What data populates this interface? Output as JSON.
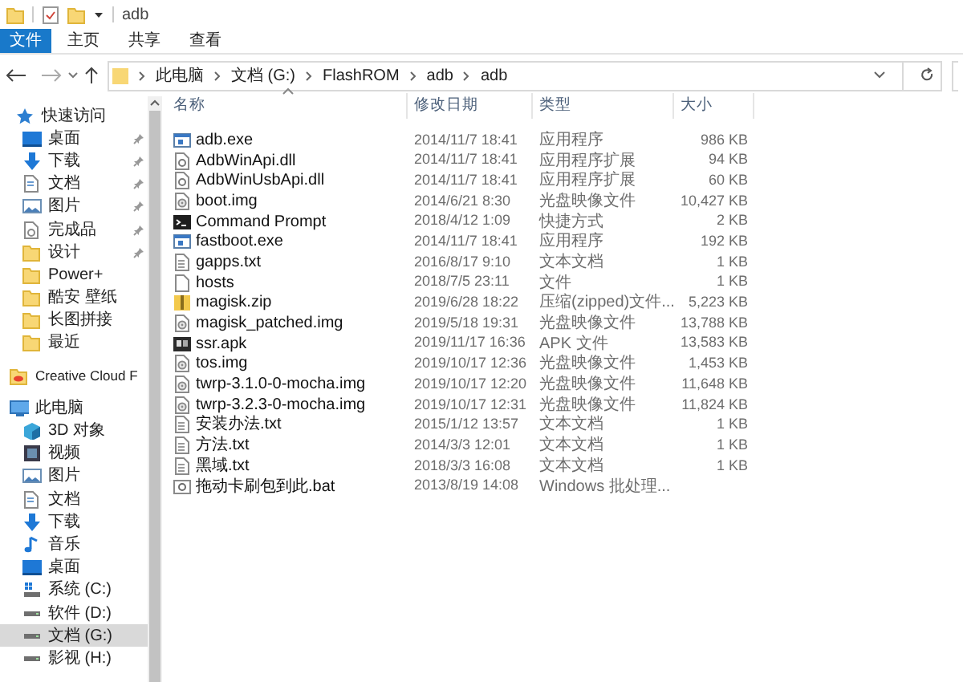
{
  "title_bar": {
    "title": "adb"
  },
  "ribbon_tabs": [
    {
      "label": "文件",
      "kind": "file_menu"
    },
    {
      "label": "主页",
      "kind": "tab"
    },
    {
      "label": "共享",
      "kind": "tab"
    },
    {
      "label": "查看",
      "kind": "tab"
    }
  ],
  "address_bar": {
    "path": [
      "此电脑",
      "文档 (G:)",
      "FlashROM",
      "adb",
      "adb"
    ]
  },
  "sidebar": {
    "groups": [
      {
        "label": "快速访问",
        "kind": "star",
        "selected": false,
        "children": [
          {
            "label": "桌面",
            "kind": "desktop",
            "pinned": true,
            "selected": false
          },
          {
            "label": "下载",
            "kind": "download",
            "pinned": true,
            "selected": false
          },
          {
            "label": "文档",
            "kind": "document",
            "pinned": true,
            "selected": false
          },
          {
            "label": "图片",
            "kind": "picture",
            "pinned": true,
            "selected": false
          },
          {
            "label": "完成品",
            "kind": "special",
            "pinned": true,
            "selected": false
          },
          {
            "label": "设计",
            "kind": "folder",
            "pinned": true,
            "selected": false
          },
          {
            "label": "Power+",
            "kind": "folder",
            "pinned": false,
            "selected": false
          },
          {
            "label": "酷安 壁纸",
            "kind": "folder",
            "pinned": false,
            "selected": false
          },
          {
            "label": "长图拼接",
            "kind": "folder",
            "pinned": false,
            "selected": false
          },
          {
            "label": "最近",
            "kind": "folder",
            "pinned": false,
            "selected": false
          }
        ]
      },
      {
        "label": "Creative Cloud F",
        "kind": "cloud",
        "selected": false
      },
      {
        "label": "此电脑",
        "kind": "computer",
        "selected": false,
        "children": [
          {
            "label": "3D 对象",
            "kind": "cube",
            "selected": false
          },
          {
            "label": "视频",
            "kind": "video",
            "selected": false
          },
          {
            "label": "图片",
            "kind": "picture",
            "selected": false
          },
          {
            "label": "文档",
            "kind": "document",
            "selected": false
          },
          {
            "label": "下载",
            "kind": "download",
            "selected": false
          },
          {
            "label": "音乐",
            "kind": "music",
            "selected": false
          },
          {
            "label": "桌面",
            "kind": "desktop",
            "selected": false
          },
          {
            "label": "系统 (C:)",
            "kind": "system_drive",
            "selected": false
          },
          {
            "label": "软件 (D:)",
            "kind": "drive",
            "selected": false
          },
          {
            "label": "文档 (G:)",
            "kind": "drive",
            "selected": true
          },
          {
            "label": "影视 (H:)",
            "kind": "drive",
            "selected": false
          }
        ]
      }
    ]
  },
  "files": {
    "columns": [
      "名称",
      "修改日期",
      "类型",
      "大小"
    ],
    "rows": [
      {
        "name": "adb.exe",
        "date": "2014/11/7 18:41",
        "type": "应用程序",
        "size": "986 KB",
        "kind": "exe"
      },
      {
        "name": "AdbWinApi.dll",
        "date": "2014/11/7 18:41",
        "type": "应用程序扩展",
        "size": "94 KB",
        "kind": "dll"
      },
      {
        "name": "AdbWinUsbApi.dll",
        "date": "2014/11/7 18:41",
        "type": "应用程序扩展",
        "size": "60 KB",
        "kind": "dll"
      },
      {
        "name": "boot.img",
        "date": "2014/6/21 8:30",
        "type": "光盘映像文件",
        "size": "10,427 KB",
        "kind": "img"
      },
      {
        "name": "Command Prompt",
        "date": "2018/4/12 1:09",
        "type": "快捷方式",
        "size": "2 KB",
        "kind": "cmd"
      },
      {
        "name": "fastboot.exe",
        "date": "2014/11/7 18:41",
        "type": "应用程序",
        "size": "192 KB",
        "kind": "exe"
      },
      {
        "name": "gapps.txt",
        "date": "2016/8/17 9:10",
        "type": "文本文档",
        "size": "1 KB",
        "kind": "txt"
      },
      {
        "name": "hosts",
        "date": "2018/7/5 23:11",
        "type": "文件",
        "size": "1 KB",
        "kind": "blank"
      },
      {
        "name": "magisk.zip",
        "date": "2019/6/28 18:22",
        "type": "压缩(zipped)文件...",
        "size": "5,223 KB",
        "kind": "zip"
      },
      {
        "name": "magisk_patched.img",
        "date": "2019/5/18 19:31",
        "type": "光盘映像文件",
        "size": "13,788 KB",
        "kind": "img"
      },
      {
        "name": "ssr.apk",
        "date": "2019/11/17 16:36",
        "type": "APK 文件",
        "size": "13,583 KB",
        "kind": "apk"
      },
      {
        "name": "tos.img",
        "date": "2019/10/17 12:36",
        "type": "光盘映像文件",
        "size": "1,453 KB",
        "kind": "img"
      },
      {
        "name": "twrp-3.1.0-0-mocha.img",
        "date": "2019/10/17 12:20",
        "type": "光盘映像文件",
        "size": "11,648 KB",
        "kind": "img"
      },
      {
        "name": "twrp-3.2.3-0-mocha.img",
        "date": "2019/10/17 12:31",
        "type": "光盘映像文件",
        "size": "11,824 KB",
        "kind": "img"
      },
      {
        "name": "安装办法.txt",
        "date": "2015/1/12 13:57",
        "type": "文本文档",
        "size": "1 KB",
        "kind": "txt"
      },
      {
        "name": "方法.txt",
        "date": "2014/3/3 12:01",
        "type": "文本文档",
        "size": "1 KB",
        "kind": "txt"
      },
      {
        "name": "黑域.txt",
        "date": "2018/3/3 16:08",
        "type": "文本文档",
        "size": "1 KB",
        "kind": "txt"
      },
      {
        "name": "拖动卡刷包到此.bat",
        "date": "2013/8/19 14:08",
        "type": "Windows 批处理...",
        "kind": "bat"
      }
    ]
  }
}
